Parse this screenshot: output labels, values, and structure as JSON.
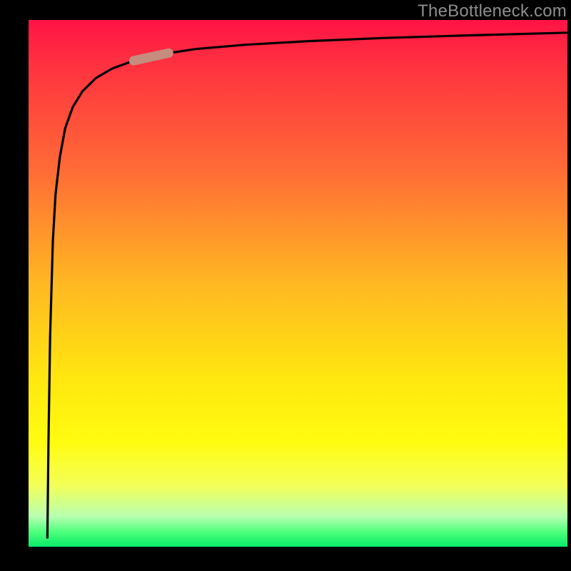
{
  "watermark": "TheBottleneck.com",
  "colors": {
    "gradient_top": "#ff1345",
    "gradient_mid": "#ffe70f",
    "gradient_bottom": "#00e868",
    "curve": "#000000",
    "marker": "#c58d7e",
    "axis": "#000000",
    "bg": "#000000"
  },
  "chart_data": {
    "type": "line",
    "title": "",
    "xlabel": "",
    "ylabel": "",
    "xlim": [
      0,
      100
    ],
    "ylim": [
      0,
      100
    ],
    "series": [
      {
        "name": "curve",
        "x": [
          3.5,
          3.7,
          4.0,
          4.5,
          5.0,
          5.8,
          6.8,
          8.2,
          10.0,
          12.5,
          15.5,
          19.5,
          24.5,
          31.0,
          40.0,
          52.0,
          66.0,
          82.0,
          100.0
        ],
        "y": [
          2.0,
          20.0,
          40.0,
          58.0,
          67.0,
          74.0,
          79.5,
          83.5,
          86.5,
          89.0,
          90.8,
          92.3,
          93.5,
          94.5,
          95.3,
          96.0,
          96.6,
          97.1,
          97.6
        ]
      }
    ],
    "marker": {
      "x_range": [
        19.5,
        26.0
      ],
      "y_range": [
        85.0,
        89.5
      ],
      "note": "approximate highlighted segment"
    }
  }
}
